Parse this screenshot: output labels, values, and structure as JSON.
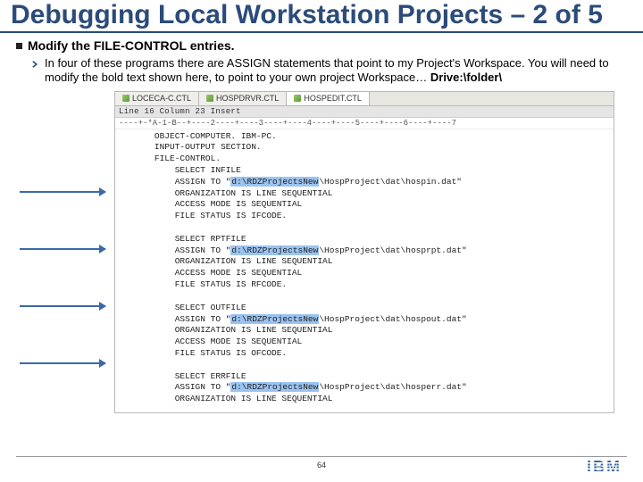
{
  "title": "Debugging Local Workstation Projects – 2 of 5",
  "bullet": "Modify the FILE-CONTROL entries.",
  "sub_prefix": "In four of these programs there are ASSIGN statements that point to my Project's Workspace.  You will need to modify the bold text shown here, to point to your own project Workspace… ",
  "sub_bold": "Drive:\\folder\\",
  "tabs": [
    {
      "label": "LOCECA-C.CTL"
    },
    {
      "label": "HOSPDRVR.CTL"
    },
    {
      "label": "HOSPEDIT.CTL"
    }
  ],
  "status": "Line 16      Column 23      Insert",
  "ruler": "----+-*A-1-B--+----2----+----3----+----4----+----5----+----6----+----7",
  "code": {
    "pre1": [
      "       OBJECT-COMPUTER. IBM-PC.",
      "       INPUT-OUTPUT SECTION.",
      "       FILE-CONTROL."
    ],
    "blocks": [
      {
        "select": "           SELECT INFILE",
        "assign_pre": "           ASSIGN TO \"",
        "assign_hl": "d:\\RDZProjectsNew",
        "assign_post": "\\HospProject\\dat\\hospin.dat\"",
        "rest": [
          "           ORGANIZATION IS LINE SEQUENTIAL",
          "           ACCESS MODE IS SEQUENTIAL",
          "           FILE STATUS IS IFCODE."
        ]
      },
      {
        "select": "           SELECT RPTFILE",
        "assign_pre": "           ASSIGN TO \"",
        "assign_hl": "d:\\RDZProjectsNew",
        "assign_post": "\\HospProject\\dat\\hosprpt.dat\"",
        "rest": [
          "           ORGANIZATION IS LINE SEQUENTIAL",
          "           ACCESS MODE IS SEQUENTIAL",
          "           FILE STATUS IS RFCODE."
        ]
      },
      {
        "select": "           SELECT OUTFILE",
        "assign_pre": "           ASSIGN TO \"",
        "assign_hl": "d:\\RDZProjectsNew",
        "assign_post": "\\HospProject\\dat\\hospout.dat\"",
        "rest": [
          "           ORGANIZATION IS LINE SEQUENTIAL",
          "           ACCESS MODE IS SEQUENTIAL",
          "           FILE STATUS IS OFCODE."
        ]
      },
      {
        "select": "           SELECT ERRFILE",
        "assign_pre": "           ASSIGN TO \"",
        "assign_hl": "d:\\RDZProjectsNew",
        "assign_post": "\\HospProject\\dat\\hosperr.dat\"",
        "rest": [
          "           ORGANIZATION IS LINE SEQUENTIAL"
        ]
      }
    ]
  },
  "page_number": "64",
  "logo_text": "IBM"
}
